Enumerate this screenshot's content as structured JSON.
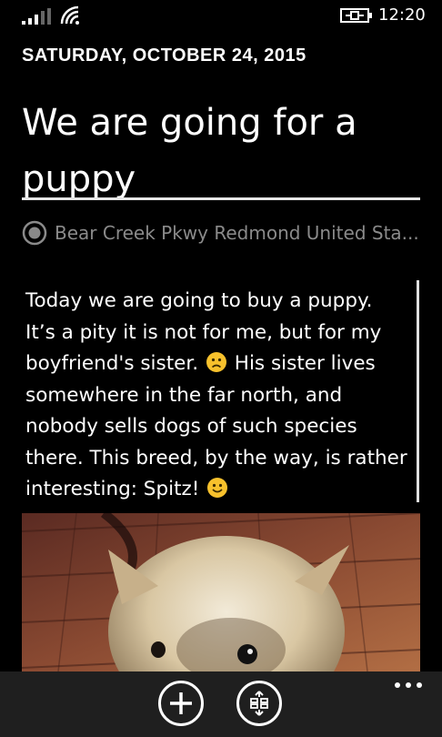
{
  "status_bar": {
    "time": "12:20",
    "signal_icon": "signal-bars-icon",
    "wifi_icon": "wifi-icon",
    "battery_icon": "battery-charging-icon"
  },
  "entry": {
    "date": "SATURDAY, OCTOBER 24, 2015",
    "title_line1": "We are going for a",
    "title_line2": "puppy",
    "location": "Bear Creek Pkwy Redmond United Sta...",
    "body_part1": "Today we are going to buy a puppy. It’s a pity it is not for me, but for my boyfriend's sister.",
    "body_part2": " His sister lives somewhere in the far north, and nobody sells dogs of such species there. This breed, by the way, is rather interesting: Spitz!",
    "photo_icon": "puppy-photo"
  },
  "app_bar": {
    "add_icon": "add-icon",
    "layout_icon": "layout-icon",
    "more_icon": "more-icon"
  },
  "colors": {
    "background": "#000000",
    "app_bar": "#1f1f1f",
    "location_text": "#8a8a8a",
    "emoji": "#f7c12c"
  }
}
